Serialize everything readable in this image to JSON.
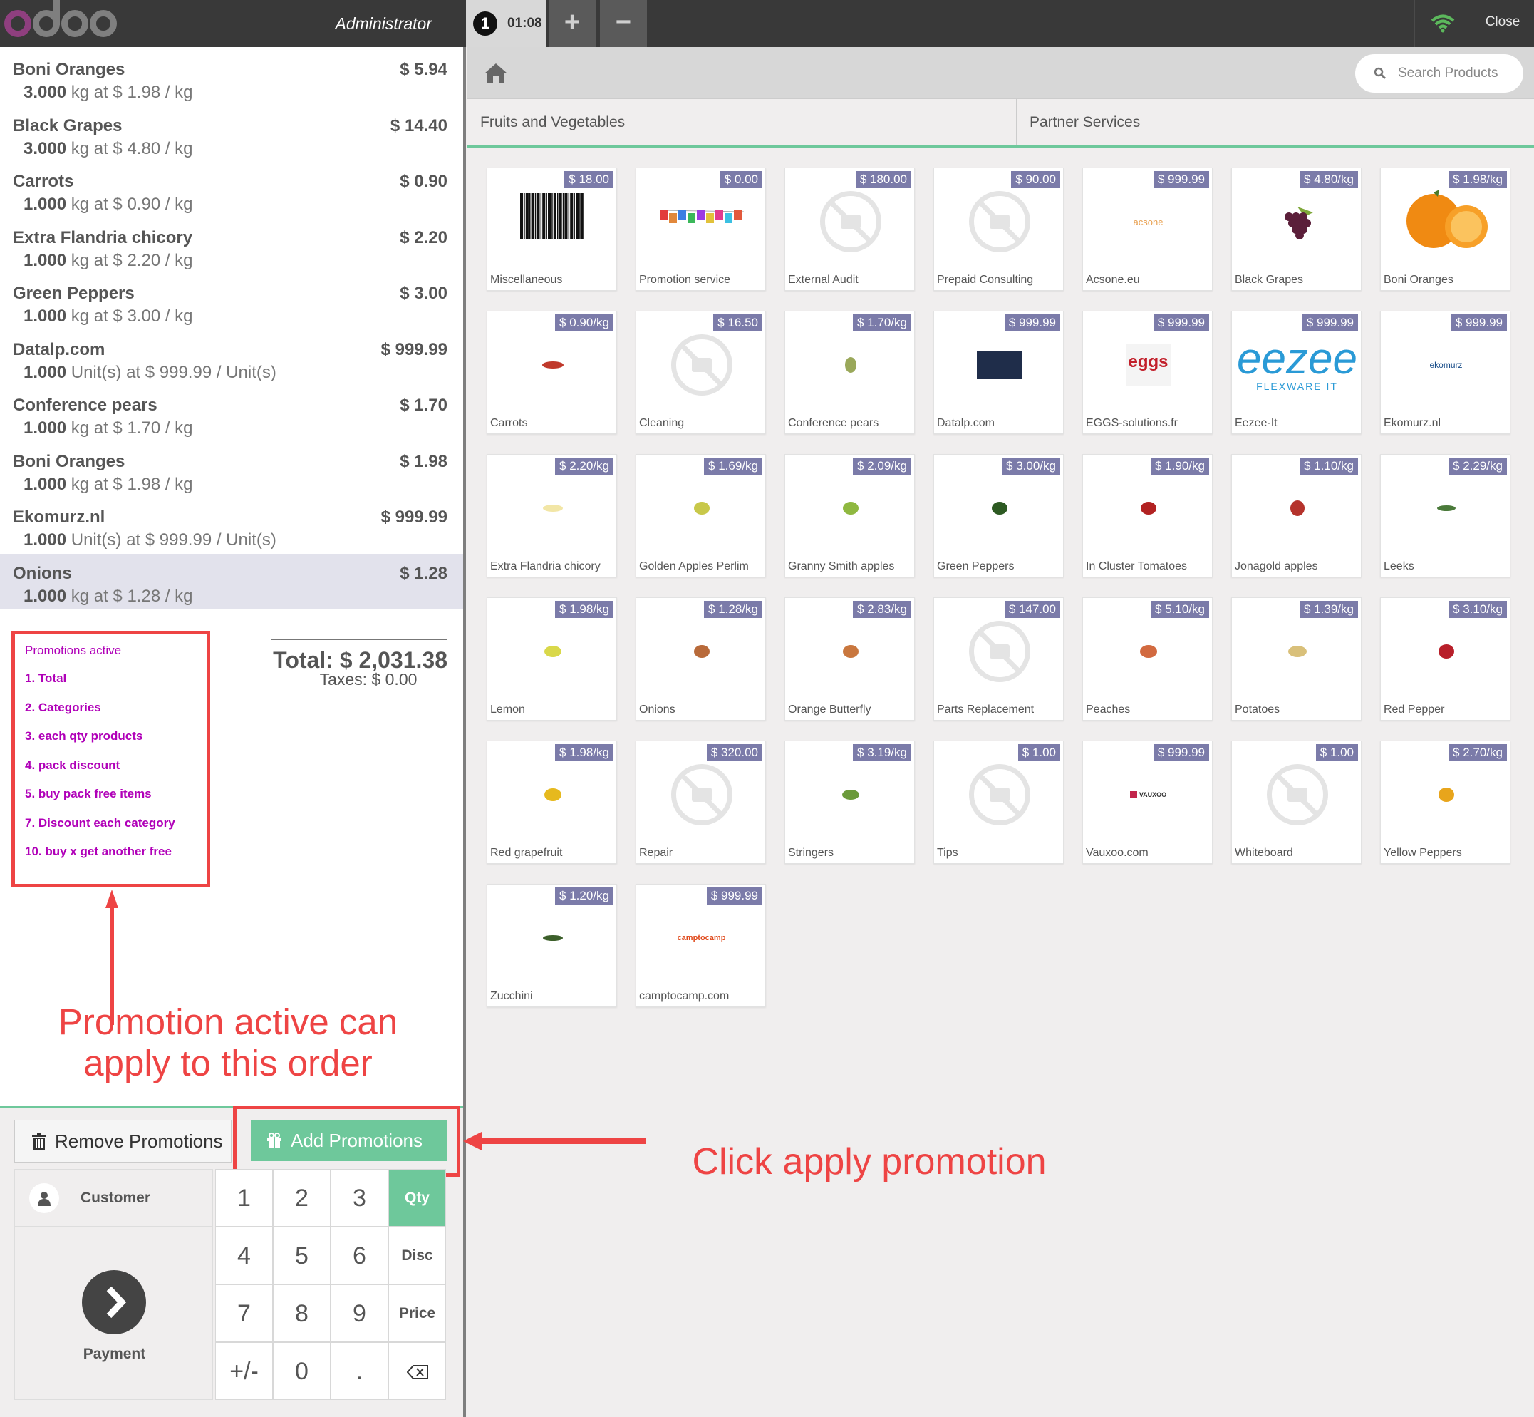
{
  "header": {
    "user": "Administrator",
    "order_number": "1",
    "order_time": "01:08",
    "add_order": "+",
    "remove_order": "−",
    "close_label": "Close"
  },
  "orderlines": [
    {
      "name": "Boni Oranges",
      "price": "$ 5.94",
      "qty": "3.000",
      "info": "kg at $ 1.98 / kg"
    },
    {
      "name": "Black Grapes",
      "price": "$ 14.40",
      "qty": "3.000",
      "info": "kg at $ 4.80 / kg"
    },
    {
      "name": "Carrots",
      "price": "$ 0.90",
      "qty": "1.000",
      "info": "kg at $ 0.90 / kg"
    },
    {
      "name": "Extra Flandria chicory",
      "price": "$ 2.20",
      "qty": "1.000",
      "info": "kg at $ 2.20 / kg"
    },
    {
      "name": "Green Peppers",
      "price": "$ 3.00",
      "qty": "1.000",
      "info": "kg at $ 3.00 / kg"
    },
    {
      "name": "Datalp.com",
      "price": "$ 999.99",
      "qty": "1.000",
      "info": "Unit(s) at $ 999.99 / Unit(s)"
    },
    {
      "name": "Conference pears",
      "price": "$ 1.70",
      "qty": "1.000",
      "info": "kg at $ 1.70 / kg"
    },
    {
      "name": "Boni Oranges",
      "price": "$ 1.98",
      "qty": "1.000",
      "info": "kg at $ 1.98 / kg"
    },
    {
      "name": "Ekomurz.nl",
      "price": "$ 999.99",
      "qty": "1.000",
      "info": "Unit(s) at $ 999.99 / Unit(s)"
    },
    {
      "name": "Onions",
      "price": "$ 1.28",
      "qty": "1.000",
      "info": "kg at $ 1.28 / kg"
    }
  ],
  "promotions": {
    "title": "Promotions active",
    "items": [
      "1. Total",
      "2. Categories",
      "3. each qty products",
      "4. pack discount",
      "5. buy pack free items",
      "7. Discount each category",
      "10. buy x get another free"
    ]
  },
  "summary": {
    "total": "Total: $ 2,031.38",
    "taxes": "Taxes: $ 0.00"
  },
  "annotations": {
    "promo_note_line1": "Promotion active can",
    "promo_note_line2": "apply to this order",
    "apply_note": "Click apply promotion"
  },
  "controls": {
    "remove_promotions": "Remove Promotions",
    "add_promotions": "Add Promotions",
    "customer": "Customer",
    "payment": "Payment",
    "keys": {
      "k1": "1",
      "k2": "2",
      "k3": "3",
      "k4": "4",
      "k5": "5",
      "k6": "6",
      "k7": "7",
      "k8": "8",
      "k9": "9",
      "k0": "0",
      "sign": "+/-",
      "dot": ".",
      "qty": "Qty",
      "disc": "Disc",
      "price": "Price"
    }
  },
  "search": {
    "placeholder": "Search Products"
  },
  "categories": [
    "Fruits and Vegetables",
    "Partner Services"
  ],
  "products": [
    {
      "name": "Miscellaneous",
      "price": "$ 18.00",
      "icon": "barcode"
    },
    {
      "name": "Promotion service",
      "price": "$ 0.00",
      "icon": "promotion-banner"
    },
    {
      "name": "External Audit",
      "price": "$ 180.00",
      "icon": "no-image"
    },
    {
      "name": "Prepaid Consulting",
      "price": "$ 90.00",
      "icon": "no-image"
    },
    {
      "name": "Acsone.eu",
      "price": "$ 999.99",
      "icon": "acsone-logo",
      "logo_text": "acsone"
    },
    {
      "name": "Black Grapes",
      "price": "$ 4.80/kg",
      "icon": "grapes"
    },
    {
      "name": "Boni Oranges",
      "price": "$ 1.98/kg",
      "icon": "oranges"
    },
    {
      "name": "Carrots",
      "price": "$ 0.90/kg",
      "icon": "carrots"
    },
    {
      "name": "Cleaning",
      "price": "$ 16.50",
      "icon": "no-image"
    },
    {
      "name": "Conference pears",
      "price": "$ 1.70/kg",
      "icon": "pears"
    },
    {
      "name": "Datalp.com",
      "price": "$ 999.99",
      "icon": "datalp-logo"
    },
    {
      "name": "EGGS-solutions.fr",
      "price": "$ 999.99",
      "icon": "eggs-logo",
      "logo_text": "eggs"
    },
    {
      "name": "Eezee-It",
      "price": "$ 999.99",
      "icon": "eezee-logo",
      "logo_text": "eezee",
      "logo_sub": "FLEXWARE IT"
    },
    {
      "name": "Ekomurz.nl",
      "price": "$ 999.99",
      "icon": "ekomurz-logo",
      "logo_text": "ekomurz"
    },
    {
      "name": "Extra Flandria chicory",
      "price": "$ 2.20/kg",
      "icon": "chicory"
    },
    {
      "name": "Golden Apples Perlim",
      "price": "$ 1.69/kg",
      "icon": "golden-apples"
    },
    {
      "name": "Granny Smith apples",
      "price": "$ 2.09/kg",
      "icon": "green-apples"
    },
    {
      "name": "Green Peppers",
      "price": "$ 3.00/kg",
      "icon": "green-peppers"
    },
    {
      "name": "In Cluster Tomatoes",
      "price": "$ 1.90/kg",
      "icon": "tomatoes"
    },
    {
      "name": "Jonagold apples",
      "price": "$ 1.10/kg",
      "icon": "jonagold-apples"
    },
    {
      "name": "Leeks",
      "price": "$ 2.29/kg",
      "icon": "leeks"
    },
    {
      "name": "Lemon",
      "price": "$ 1.98/kg",
      "icon": "lemon"
    },
    {
      "name": "Onions",
      "price": "$ 1.28/kg",
      "icon": "onions"
    },
    {
      "name": "Orange Butterfly",
      "price": "$ 2.83/kg",
      "icon": "orange-butterfly"
    },
    {
      "name": "Parts Replacement",
      "price": "$ 147.00",
      "icon": "no-image"
    },
    {
      "name": "Peaches",
      "price": "$ 5.10/kg",
      "icon": "peaches"
    },
    {
      "name": "Potatoes",
      "price": "$ 1.39/kg",
      "icon": "potatoes"
    },
    {
      "name": "Red Pepper",
      "price": "$ 3.10/kg",
      "icon": "red-pepper"
    },
    {
      "name": "Red grapefruit",
      "price": "$ 1.98/kg",
      "icon": "grapefruit"
    },
    {
      "name": "Repair",
      "price": "$ 320.00",
      "icon": "no-image"
    },
    {
      "name": "Stringers",
      "price": "$ 3.19/kg",
      "icon": "stringers"
    },
    {
      "name": "Tips",
      "price": "$ 1.00",
      "icon": "no-image"
    },
    {
      "name": "Vauxoo.com",
      "price": "$ 999.99",
      "icon": "vauxoo-logo",
      "logo_text": "VAUXOO"
    },
    {
      "name": "Whiteboard",
      "price": "$ 1.00",
      "icon": "no-image"
    },
    {
      "name": "Yellow Peppers",
      "price": "$ 2.70/kg",
      "icon": "yellow-peppers"
    },
    {
      "name": "Zucchini",
      "price": "$ 1.20/kg",
      "icon": "zucchini"
    },
    {
      "name": "camptocamp.com",
      "price": "$ 999.99",
      "icon": "camptocamp-logo",
      "logo_text": "camptocamp"
    }
  ],
  "colors": {
    "accent": "#6ec89b",
    "promo_text": "#b000b8",
    "annotation": "#ee4444",
    "price_badge": "#7b7ba9"
  }
}
